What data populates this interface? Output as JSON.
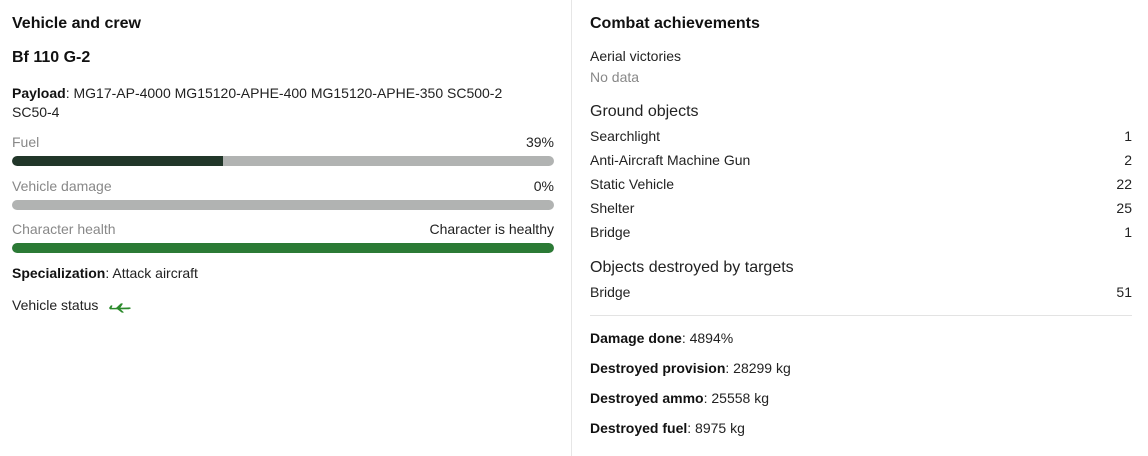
{
  "left": {
    "title": "Vehicle and crew",
    "vehicle_name": "Bf 110 G-2",
    "payload_label": "Payload",
    "payload_value": ": MG17-AP-4000 MG15120-APHE-400 MG15120-APHE-350 SC500-2 SC50-4",
    "fuel": {
      "label": "Fuel",
      "value": "39%",
      "fraction": 0.39,
      "color": "#213629"
    },
    "damage": {
      "label": "Vehicle damage",
      "value": "0%",
      "fraction": 0.0,
      "color": "#213629"
    },
    "health": {
      "label": "Character health",
      "value": "Character is healthy",
      "fraction": 1.0,
      "color": "#2b7a35"
    },
    "spec_label": "Specialization",
    "spec_value": ": Attack aircraft",
    "status_label": "Vehicle status",
    "status_icon": "plane-icon",
    "status_color": "#2b8a2b"
  },
  "right": {
    "title": "Combat achievements",
    "aerial_label": "Aerial victories",
    "aerial_value": "No data",
    "ground_title": "Ground objects",
    "ground_items": [
      {
        "name": "Searchlight",
        "count": "1"
      },
      {
        "name": "Anti-Aircraft Machine Gun",
        "count": "2"
      },
      {
        "name": "Static Vehicle",
        "count": "22"
      },
      {
        "name": "Shelter",
        "count": "25"
      },
      {
        "name": "Bridge",
        "count": "1"
      }
    ],
    "targets_title": "Objects destroyed by targets",
    "target_items": [
      {
        "name": "Bridge",
        "count": "51"
      }
    ],
    "damage_label": "Damage done",
    "damage_value": ": 4894%",
    "provision_label": "Destroyed provision",
    "provision_value": ": 28299 kg",
    "ammo_label": "Destroyed ammo",
    "ammo_value": ": 25558 kg",
    "fuel_label": "Destroyed fuel",
    "fuel_value": ": 8975 kg"
  }
}
